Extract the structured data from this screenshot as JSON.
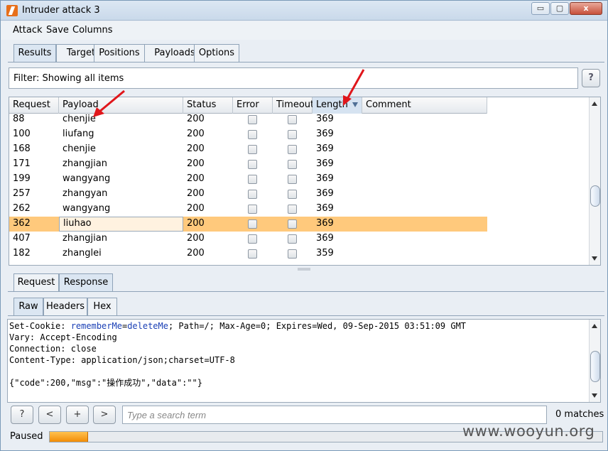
{
  "window": {
    "title": "Intruder attack 3",
    "min_glyph": "▭",
    "max_glyph": "▢",
    "close_glyph": "x"
  },
  "menu": [
    "Attack",
    "Save",
    "Columns"
  ],
  "tabs": [
    {
      "label": "Results",
      "active": true
    },
    {
      "label": "Target",
      "active": false
    },
    {
      "label": "Positions",
      "active": false
    },
    {
      "label": "Payloads",
      "active": false
    },
    {
      "label": "Options",
      "active": false
    }
  ],
  "filter": {
    "text": "Filter: Showing all items",
    "help": "?"
  },
  "table": {
    "columns": [
      "Request",
      "Payload",
      "Status",
      "Error",
      "Timeout",
      "Length",
      "Comment"
    ],
    "sorted_column": "Length",
    "rows": [
      {
        "request": "88",
        "payload": "chenjie",
        "status": "200",
        "length": "369",
        "selected": false
      },
      {
        "request": "100",
        "payload": "liufang",
        "status": "200",
        "length": "369",
        "selected": false
      },
      {
        "request": "168",
        "payload": "chenjie",
        "status": "200",
        "length": "369",
        "selected": false
      },
      {
        "request": "171",
        "payload": "zhangjian",
        "status": "200",
        "length": "369",
        "selected": false
      },
      {
        "request": "199",
        "payload": "wangyang",
        "status": "200",
        "length": "369",
        "selected": false
      },
      {
        "request": "257",
        "payload": "zhangyan",
        "status": "200",
        "length": "369",
        "selected": false
      },
      {
        "request": "262",
        "payload": "wangyang",
        "status": "200",
        "length": "369",
        "selected": false
      },
      {
        "request": "362",
        "payload": "liuhao",
        "status": "200",
        "length": "369",
        "selected": true
      },
      {
        "request": "407",
        "payload": "zhangjian",
        "status": "200",
        "length": "369",
        "selected": false
      },
      {
        "request": "182",
        "payload": "zhanglei",
        "status": "200",
        "length": "359",
        "selected": false
      }
    ]
  },
  "message_tabs": [
    {
      "label": "Request",
      "active": false
    },
    {
      "label": "Response",
      "active": true
    }
  ],
  "view_tabs": [
    {
      "label": "Raw",
      "active": true
    },
    {
      "label": "Headers",
      "active": false
    },
    {
      "label": "Hex",
      "active": false
    }
  ],
  "response": {
    "line1_a": "Set-Cookie: ",
    "line1_kw1": "rememberMe",
    "line1_b": "=",
    "line1_kw2": "deleteMe",
    "line1_c": "; Path=/; Max-Age=0; Expires=Wed, 09-Sep-2015 03:51:09 GMT",
    "line2": "Vary: Accept-Encoding",
    "line3": "Connection: close",
    "line4": "Content-Type: application/json;charset=UTF-8",
    "line5": "",
    "line6": "{\"code\":200,\"msg\":\"操作成功\",\"data\":\"\"}"
  },
  "search": {
    "help": "?",
    "prev": "<",
    "add": "+",
    "next": ">",
    "placeholder": "Type a search term",
    "matches": "0 matches"
  },
  "status": {
    "text": "Paused",
    "progress_fraction": 0.07
  },
  "watermark": "www.wooyun.org"
}
